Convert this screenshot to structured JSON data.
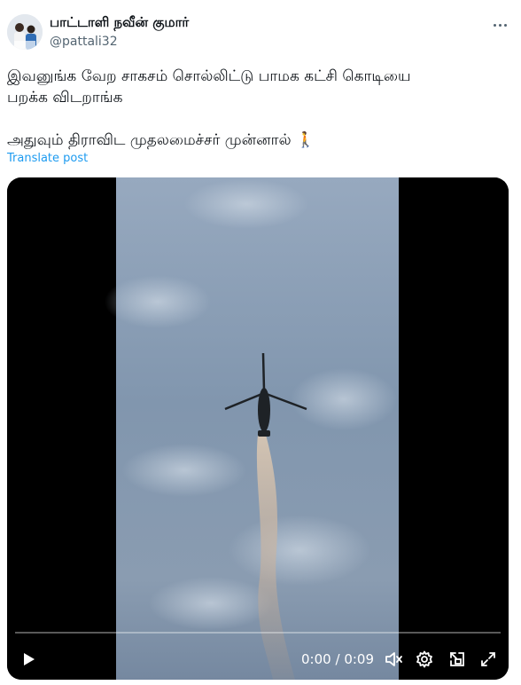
{
  "author": {
    "name": "பாட்டாளி நவீன் குமார்",
    "handle": "@pattali32"
  },
  "post": {
    "line1": "இவனுங்க வேற சாகசம் சொல்லிட்டு பாமக கட்சி கொடியை",
    "line2": "பறக்க விடறாங்க",
    "line3": "அதுவும் திராவிட முதலமைச்சர் முன்னால்",
    "emoji": "🚶",
    "translate_label": "Translate post"
  },
  "video": {
    "current_time": "0:00",
    "separator": "/",
    "duration": "0:09",
    "progress": 0
  },
  "icons": {
    "more": "more-icon",
    "play": "play-icon",
    "mute": "mute-icon",
    "settings": "settings-icon",
    "pip": "pip-icon",
    "fullscreen": "fullscreen-icon"
  },
  "colors": {
    "link": "#1d9bf0",
    "secondary": "#536471",
    "text": "#0f1419"
  }
}
